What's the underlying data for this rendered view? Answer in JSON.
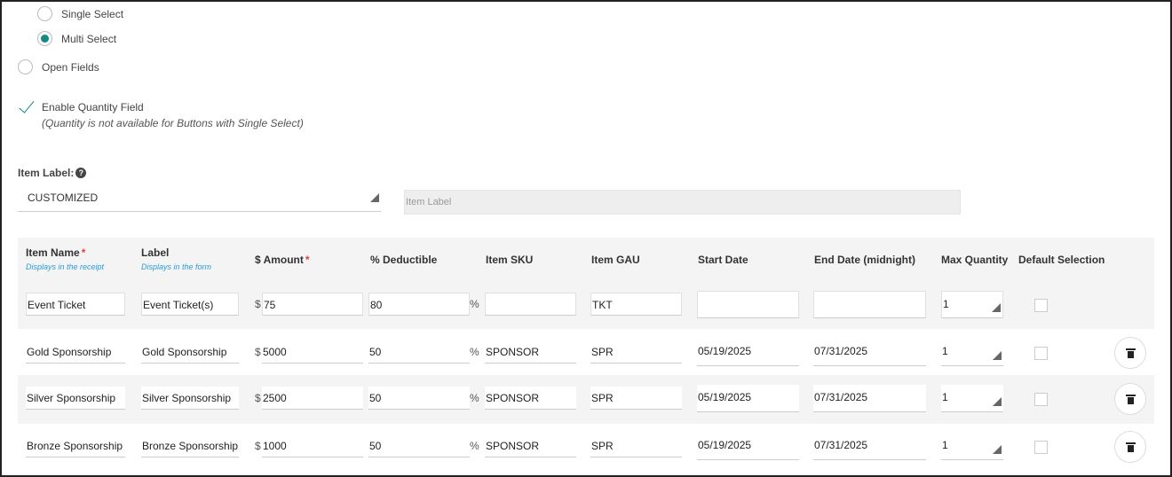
{
  "options": {
    "single_select": "Single Select",
    "multi_select": "Multi Select",
    "open_fields": "Open Fields"
  },
  "quantity": {
    "label": "Enable Quantity Field",
    "note": "(Quantity is not available for Buttons with Single Select)"
  },
  "item_label": {
    "title": "Item Label:",
    "help_glyph": "?",
    "select_value": "CUSTOMIZED",
    "input_placeholder": "Item Label"
  },
  "table": {
    "headers": {
      "item_name": "Item Name",
      "item_name_sub": "Displays in the receipt",
      "label": "Label",
      "label_sub": "Displays in the form",
      "amount": "$ Amount",
      "deductible": "% Deductible",
      "sku": "Item SKU",
      "gau": "Item GAU",
      "start_date": "Start Date",
      "end_date": "End Date (midnight)",
      "max_qty": "Max Quantity",
      "default_selection": "Default Selection",
      "required_mark": "*"
    },
    "currency": "$",
    "percent": "%",
    "rows": [
      {
        "item_name": "Event Ticket",
        "label": "Event Ticket(s)",
        "amount": "75",
        "deductible": "80",
        "sku": "",
        "gau": "TKT",
        "start": "",
        "end": "",
        "max_qty": "1"
      },
      {
        "item_name": "Gold Sponsorship",
        "label": "Gold Sponsorship",
        "amount": "5000",
        "deductible": "50",
        "sku": "SPONSOR",
        "gau": "SPR",
        "start": "05/19/2025",
        "end": "07/31/2025",
        "max_qty": "1"
      },
      {
        "item_name": "Silver Sponsorship",
        "label": "Silver Sponsorship",
        "amount": "2500",
        "deductible": "50",
        "sku": "SPONSOR",
        "gau": "SPR",
        "start": "05/19/2025",
        "end": "07/31/2025",
        "max_qty": "1"
      },
      {
        "item_name": "Bronze Sponsorship",
        "label": "Bronze Sponsorship",
        "amount": "1000",
        "deductible": "50",
        "sku": "SPONSOR",
        "gau": "SPR",
        "start": "05/19/2025",
        "end": "07/31/2025",
        "max_qty": "1"
      }
    ]
  },
  "colors": {
    "accent": "#138a82",
    "required": "#e04040",
    "hint": "#2a9bd6"
  }
}
